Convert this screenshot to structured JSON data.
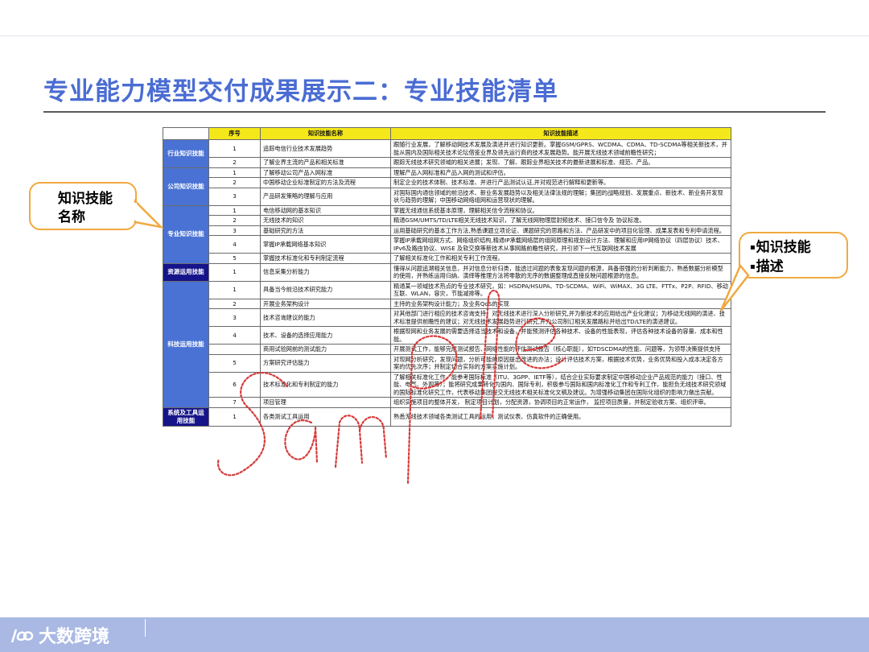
{
  "slide": {
    "title": "专业能力模型交付成果展示二：专业技能清单"
  },
  "table": {
    "headers": [
      "序号",
      "知识技能名称",
      "知识技能描述"
    ],
    "groups": [
      {
        "category": "行业知识技能",
        "style": "light",
        "rows": [
          [
            "1",
            "追踪电信行业技术发展趋势",
            "跟随行业发展，了解移动网技术发展及演进并进行知识更新。掌握GSM/GPRS、WCDMA、CDMA、TD-SCDMA等相关新技术，并能从国内及国际相关技术论坛借鉴业界及领先运行商的技术发展趋势。能开展无线技术领域前瞻性研究；"
          ],
          [
            "2",
            "了解业界主流的产品和相关标准",
            "跟踪无线技术研究领域的相关进展；发现、了解、跟踪业界相关技术的最新进展和标准、规范、产品。"
          ]
        ]
      },
      {
        "category": "公司知识技能",
        "style": "light",
        "rows": [
          [
            "1",
            "了解移动公司产品入网标准",
            "理解产品入网标准和产品入网的测试和评估。"
          ],
          [
            "2",
            "中国移动企业标准制定的方法及流程",
            "制定企业的技术体制、技术标准、并进行产品测试认证,并对规范进行解释和更新等。"
          ],
          [
            "3",
            "产品研发策略的理解与应用",
            "对国际国内通信领域的前沿技术、新业务发展趋势以及相关法律法规的理解；集团的战略规划、发展重点、新技术、新业务开发现状与趋势的理解；中国移动网络组网和运营现状的理解。"
          ]
        ]
      },
      {
        "category": "专业知识技能",
        "style": "light",
        "rows": [
          [
            "1",
            "电信移动网的基本知识",
            "掌握无线通信系统基本原理，理解相关信令流程和协议。"
          ],
          [
            "2",
            "无线技术的知识",
            "精通GSM/UMTS/TD/LTE相关无线技术知识，了解无线网物理层射频技术、接口信令及 协议标准。"
          ],
          [
            "3",
            "基础研究的方法",
            "运用基础研究的基本工作方法,熟悉课题立项论证、课题研究的思路和方法、产品研发中的项目化管理、成果发表和专利申请流程。"
          ],
          [
            "4",
            "掌握IP承载网络基本知识",
            "掌握IP承载网组网方式、网络组织结构,精通IP承载网络层的组网原理和规划设计方法、理解和应用IP网络协议（四层协议）技术、IPv6及路由协议、WISE 及软交换等新技术从事网路前瞻性研究，并引领下一代互联网技术发展"
          ],
          [
            "5",
            "掌握技术标准化和专利制定流程",
            "了解相关标准化工作和相关专利工作流程。"
          ]
        ]
      },
      {
        "category": "资源运用技能",
        "style": "dark",
        "rows": [
          [
            "1",
            "信息采集分析能力",
            "懂得从问题追溯相关信息，并对信息分析归类，能透过问题的表象发现问题的根源，具备很强的分析判断能力，熟悉数据分析模型的使用，并熟练运用归纳、演绎等推理方法将零散的无序的数据整理成直接反映问题根源的信息。"
          ]
        ]
      },
      {
        "category": "科技运用技能",
        "style": "light",
        "rows": [
          [
            "1",
            "具备当今前沿技术研究能力",
            "精通某一领域技术热点的专业技术研究，如：HSDPA/HSUPA、TD-SCDMA、WiFi、WiMAX、3G LTE、FTTx、P2P、RFID、移动互联、WLAN，容灾，节能减排等。"
          ],
          [
            "2",
            "开展业务架构设计",
            "主持的业务架构设计能力；及业务QoS的实现"
          ],
          [
            "3",
            "技术咨询建议的能力",
            "对其他部门进行相应的技术咨询支持；对无线技术进行深入分析研究,并为新技术的应用给出产业化建议；为移动无线网的演进、技术标准提供前瞻性的建议；对无线技术发展趋势进行研究,并为公司制订相关发展路标并给出TD/LTE的演进建议。"
          ],
          [
            "4",
            "技术、设备的选择应用能力",
            "根据现网和业务发展的需要选择适当技术和设备，并能预测评估各种技术、设备的性能表现，评估各种技术设备的容量、成本和性能。"
          ],
          [
            "",
            "商用试验网前的测试能力",
            "开展测试工作，能够完成测试报告、网络性能的评估测试报告（核心职能），如TDSCDMA的性能、问题等，为领导决策提供支持"
          ],
          [
            "5",
            "方案研究评估能力",
            "对现网分析研究，发现问题，分析可能的原因提出改进的办法；设计评估技术方案，根据技术优势，业务优势和投入成本决定各方案的优先次序；并制定切合实际的方案实施计划。"
          ],
          [
            "6",
            "技术标准化和专利制定的能力",
            "了解相关标准化工作，能参考国际标准（ITU、3GPP、IETF等），结合企业实际要求制定中国移动企业产品规范的能力（接口、性能、电气、外观等）；能将研究成果转化为国内、国际专利，积极参与国际和国内标准化工作和专利工作，能担负无线技术研究领域的国际标准化研究工作，代表移动集团提交无线技术相关标准化文稿及建议。为增强移动集团在国际化组织的影响力做出贡献。"
          ],
          [
            "7",
            "项目管理",
            "组织实施项目的整体开发， 制定项目计划，分配资源，协调项目的正常运作， 监控项目质量，并制定验收方案、组织评审。"
          ]
        ]
      },
      {
        "category": "系统及工具运用技能",
        "style": "dark",
        "rows": [
          [
            "1",
            "各类测试工具运用",
            "熟悉无线技术领域各类测试工具的运用，测试仪表、仿真软件的正确使用。"
          ]
        ]
      }
    ]
  },
  "callouts": {
    "left": [
      "知识技能",
      "名称"
    ],
    "right": [
      "知识技能",
      "描述"
    ]
  },
  "watermark": {
    "text": "Sample",
    "color": "#d83a3a"
  },
  "footer": {
    "brand": "大数跨境"
  },
  "colors": {
    "title": "#4a6cd3",
    "header": "#f5e81a",
    "category": "#4a72d4",
    "category_dark": "#15148a",
    "callout_border": "#f0a940",
    "footer": "#a9b9e3"
  }
}
